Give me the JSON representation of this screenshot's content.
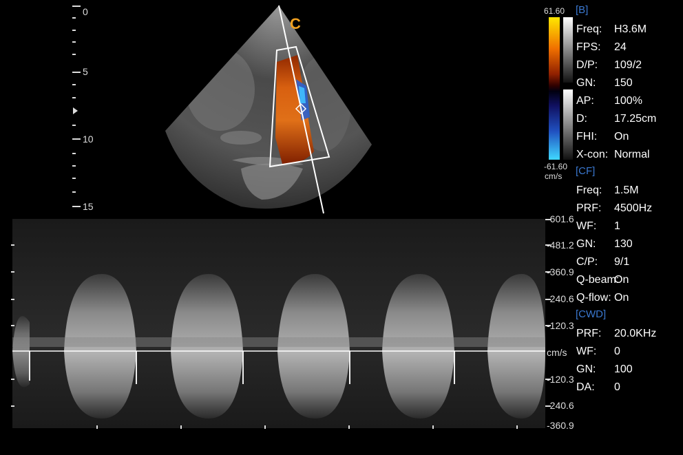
{
  "orientation_mark": "C",
  "depth_scale": {
    "labels": [
      "0",
      "5",
      "10",
      "15"
    ]
  },
  "color_bar": {
    "top_value": "61.60",
    "bottom_value": "-61.60",
    "unit": "cm/s"
  },
  "sections": [
    {
      "title": "[B]",
      "rows": [
        {
          "key": "Freq:",
          "value": "H3.6M"
        },
        {
          "key": "FPS:",
          "value": "24"
        },
        {
          "key": "D/P:",
          "value": "109/2"
        },
        {
          "key": "GN:",
          "value": "150"
        },
        {
          "key": "AP:",
          "value": "100%"
        },
        {
          "key": "D:",
          "value": "17.25cm"
        },
        {
          "key": "FHI:",
          "value": "On"
        },
        {
          "key": "X-con:",
          "value": "Normal"
        }
      ]
    },
    {
      "title": "[CF]",
      "rows": [
        {
          "key": "Freq:",
          "value": "1.5M"
        },
        {
          "key": "PRF:",
          "value": "4500Hz"
        },
        {
          "key": "WF:",
          "value": "1"
        },
        {
          "key": "GN:",
          "value": "130"
        },
        {
          "key": "C/P:",
          "value": "9/1"
        },
        {
          "key": "Q-beam:",
          "value": "On"
        },
        {
          "key": "Q-flow:",
          "value": "On"
        }
      ]
    },
    {
      "title": "[CWD]",
      "rows": [
        {
          "key": "PRF:",
          "value": "20.0KHz"
        },
        {
          "key": "WF:",
          "value": "0"
        },
        {
          "key": "GN:",
          "value": "100"
        },
        {
          "key": "DA:",
          "value": "0"
        }
      ]
    }
  ],
  "velocity_scale": {
    "labels": [
      "-601.6",
      "-481.2",
      "-360.9",
      "-240.6",
      "-120.3",
      "cm/s",
      "-120.3",
      "-240.6",
      "-360.9"
    ]
  }
}
